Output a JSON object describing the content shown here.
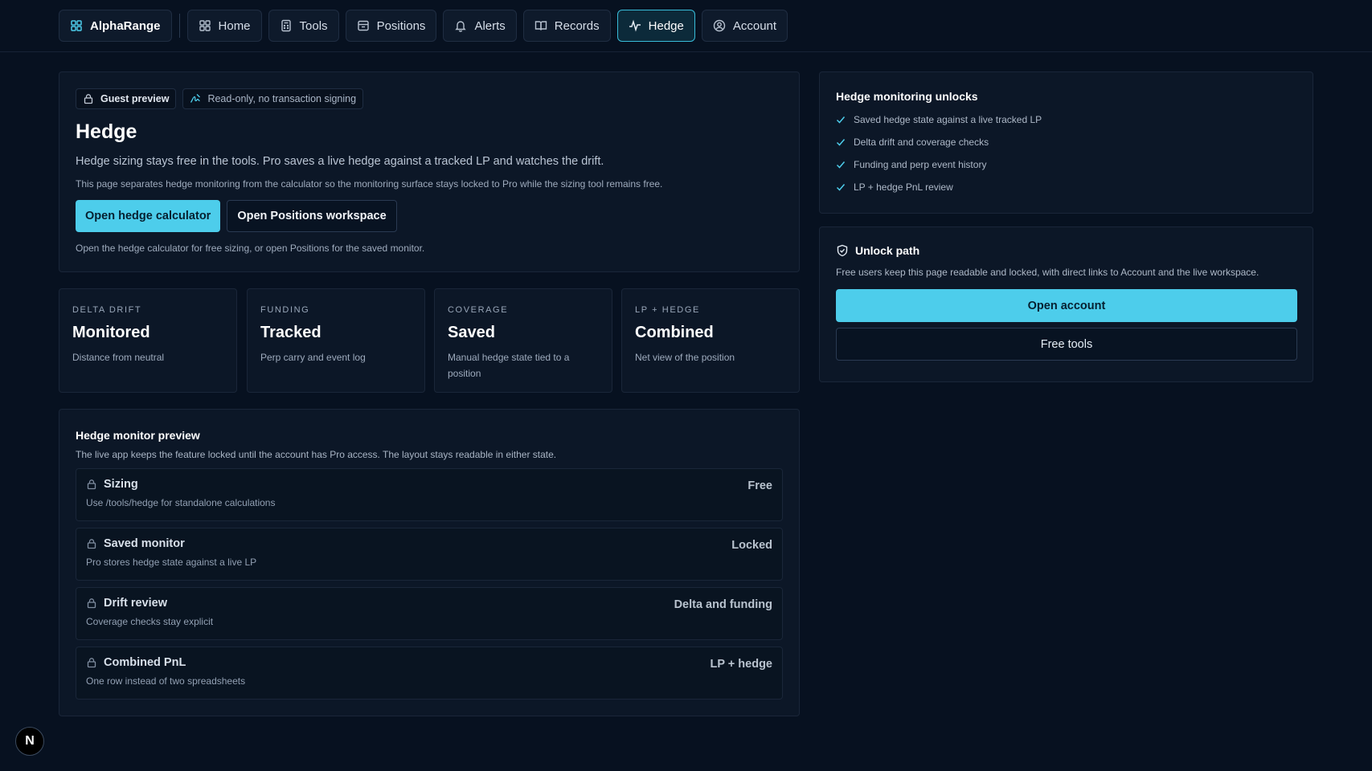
{
  "nav": {
    "brand": "AlphaRange",
    "items": [
      {
        "label": "Home",
        "icon": "grid-icon"
      },
      {
        "label": "Tools",
        "icon": "calculator-icon"
      },
      {
        "label": "Positions",
        "icon": "archive-icon"
      },
      {
        "label": "Alerts",
        "icon": "bell-icon"
      },
      {
        "label": "Records",
        "icon": "book-open-icon"
      },
      {
        "label": "Hedge",
        "icon": "activity-icon",
        "active": true
      },
      {
        "label": "Account",
        "icon": "user-circle-icon"
      }
    ]
  },
  "hero": {
    "badge_guest": "Guest preview",
    "badge_readonly": "Read-only, no transaction signing",
    "title": "Hedge",
    "lead": "Hedge sizing stays free in the tools. Pro saves a live hedge against a tracked LP and watches the drift.",
    "sub": "This page separates hedge monitoring from the calculator so the monitoring surface stays locked to Pro while the sizing tool remains free.",
    "primary_label": "Open hedge calculator",
    "secondary_label": "Open Positions workspace",
    "note": "Open the hedge calculator for free sizing, or open Positions for the saved monitor."
  },
  "stats": [
    {
      "key": "DELTA DRIFT",
      "value": "Monitored",
      "desc": "Distance from neutral"
    },
    {
      "key": "FUNDING",
      "value": "Tracked",
      "desc": "Perp carry and event log"
    },
    {
      "key": "COVERAGE",
      "value": "Saved",
      "desc": "Manual hedge state tied to a position"
    },
    {
      "key": "LP + HEDGE",
      "value": "Combined",
      "desc": "Net view of the position"
    }
  ],
  "monitor": {
    "title": "Hedge monitor preview",
    "desc": "The live app keeps the feature locked until the account has Pro access. The layout stays readable in either state.",
    "rows": [
      {
        "title": "Sizing",
        "desc": "Use /tools/hedge for standalone calculations",
        "status": "Free"
      },
      {
        "title": "Saved monitor",
        "desc": "Pro stores hedge state against a live LP",
        "status": "Locked"
      },
      {
        "title": "Drift review",
        "desc": "Coverage checks stay explicit",
        "status": "Delta and funding"
      },
      {
        "title": "Combined PnL",
        "desc": "One row instead of two spreadsheets",
        "status": "LP + hedge"
      }
    ]
  },
  "unlocks": {
    "title": "Hedge monitoring unlocks",
    "items": [
      "Saved hedge state against a live tracked LP",
      "Delta drift and coverage checks",
      "Funding and perp event history",
      "LP + hedge PnL review"
    ]
  },
  "unlock_path": {
    "title": "Unlock path",
    "desc": "Free users keep this page readable and locked, with direct links to Account and the live workspace.",
    "primary_label": "Open account",
    "secondary_label": "Free tools"
  },
  "dev_badge": "N",
  "colors": {
    "background": "#071120",
    "accent": "#4dcdeb",
    "panel": "#0c1727"
  }
}
